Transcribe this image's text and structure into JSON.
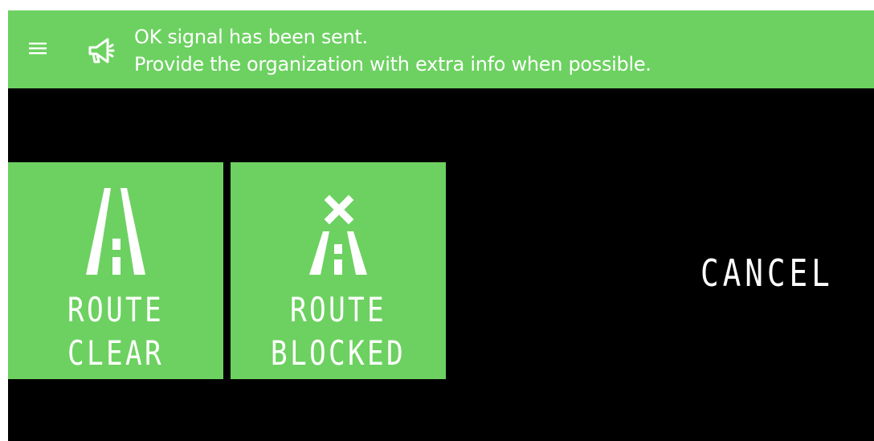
{
  "banner": {
    "line1": "OK signal has been sent.",
    "line2": "Provide the organization with extra info when possible.",
    "background": "#6cd160",
    "icons": [
      "menu-icon",
      "megaphone-icon"
    ]
  },
  "tiles": [
    {
      "line1": "ROUTE",
      "line2": "CLEAR",
      "icon": "road-icon"
    },
    {
      "line1": "ROUTE",
      "line2": "BLOCKED",
      "icon": "road-blocked-icon"
    }
  ],
  "cancel_label": "CANCEL",
  "colors": {
    "accent": "#6cd160",
    "screen": "#000000",
    "text": "#ffffff"
  }
}
